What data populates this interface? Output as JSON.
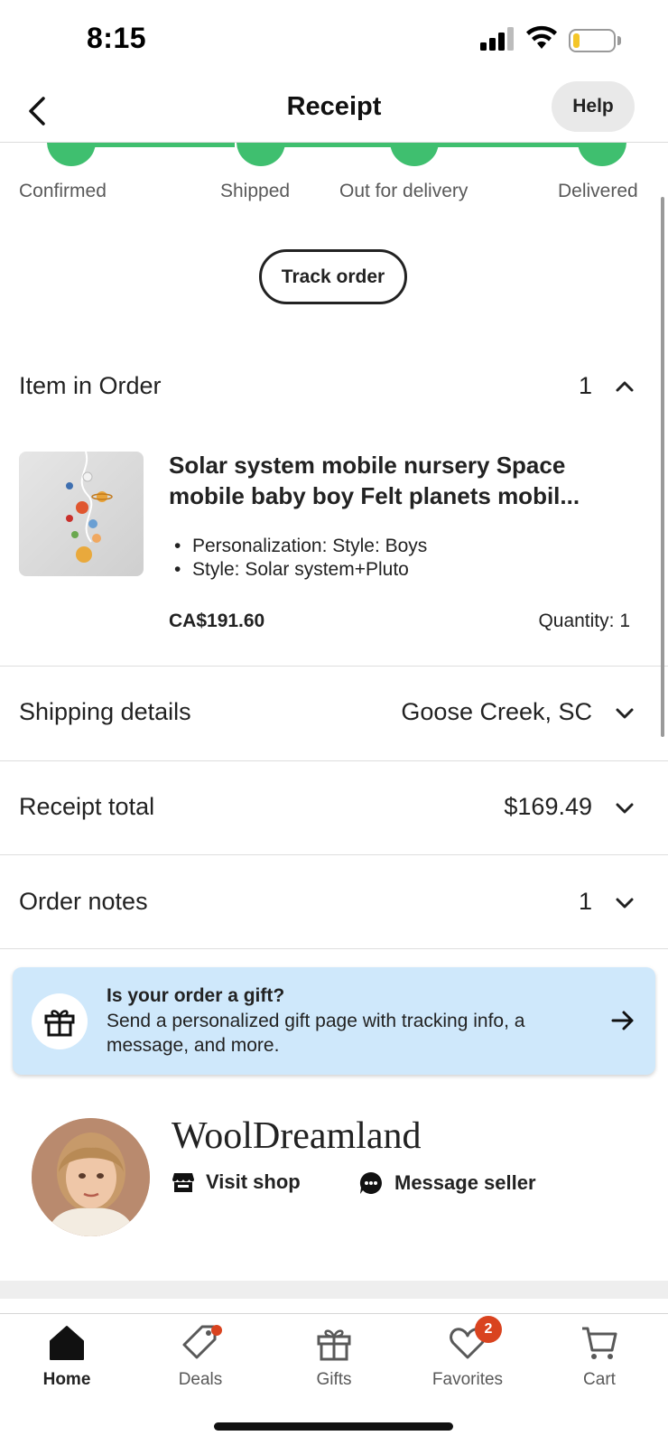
{
  "status_bar": {
    "time": "8:15"
  },
  "header": {
    "title": "Receipt",
    "help_label": "Help"
  },
  "tracker": {
    "steps": [
      {
        "label": "Confirmed"
      },
      {
        "label": "Shipped"
      },
      {
        "label": "Out for delivery"
      },
      {
        "label": "Delivered"
      }
    ],
    "accent_color": "#3fbf6f",
    "track_button_label": "Track order"
  },
  "item_section": {
    "label": "Item in Order",
    "count": "1",
    "item": {
      "title": "Solar system mobile nursery Space mobile baby boy Felt planets mobil...",
      "attributes": [
        "Personalization:  Style: Boys",
        "Style: Solar system+Pluto"
      ],
      "price": "CA$191.60",
      "quantity": "Quantity: 1"
    }
  },
  "shipping": {
    "label": "Shipping details",
    "value": "Goose Creek, SC"
  },
  "receipt_total": {
    "label": "Receipt total",
    "value": "$169.49"
  },
  "order_notes": {
    "label": "Order notes",
    "value": "1"
  },
  "gift_banner": {
    "title": "Is your order a gift?",
    "text": "Send a personalized gift page with tracking info, a message, and more."
  },
  "seller": {
    "shop_name": "WoolDreamland",
    "visit_shop_label": "Visit shop",
    "message_seller_label": "Message seller"
  },
  "tab_bar": {
    "tabs": [
      {
        "label": "Home",
        "icon": "home-icon",
        "active": true
      },
      {
        "label": "Deals",
        "icon": "tag-icon"
      },
      {
        "label": "Gifts",
        "icon": "gift-icon"
      },
      {
        "label": "Favorites",
        "icon": "heart-icon",
        "badge": "2"
      },
      {
        "label": "Cart",
        "icon": "cart-icon"
      }
    ],
    "badge_color": "#d9431f"
  }
}
